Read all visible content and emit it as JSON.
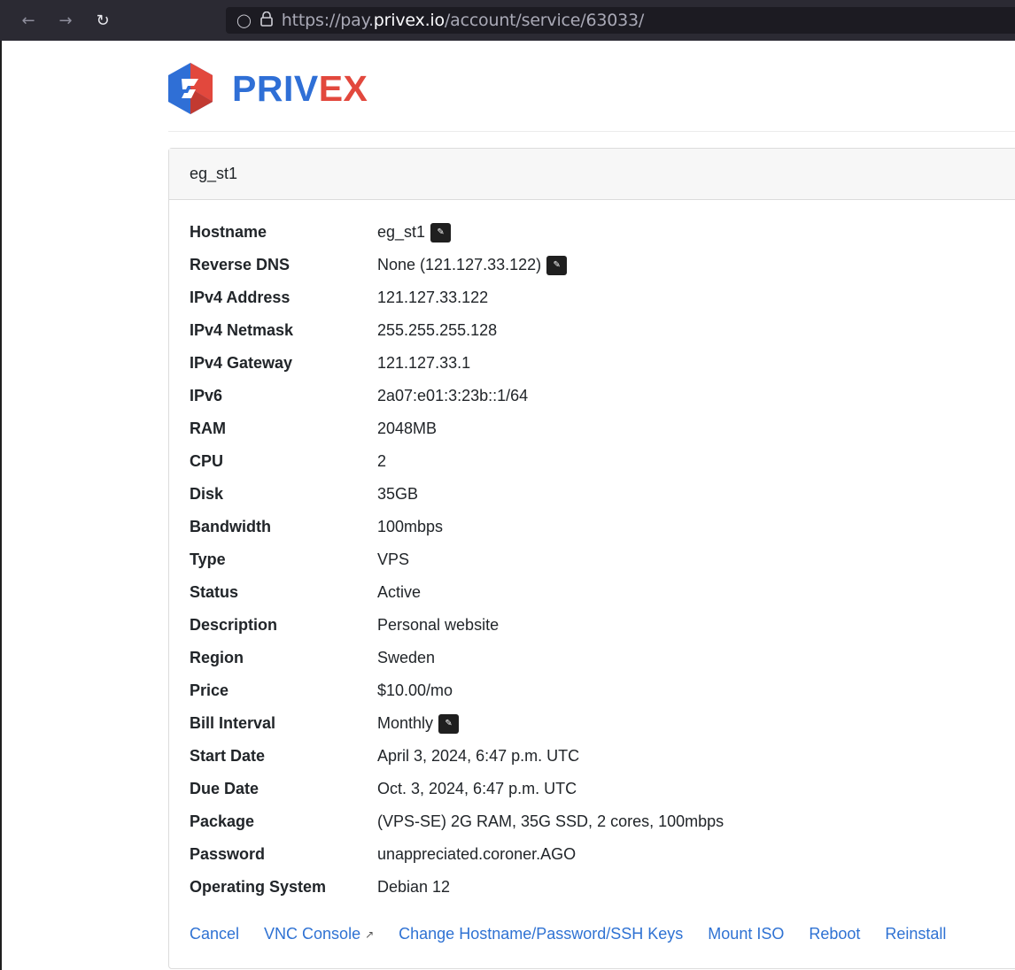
{
  "browser": {
    "url_prefix": "https://pay.",
    "url_domain": "privex.io",
    "url_path": "/account/service/63033/",
    "back_icon": "arrow-left-icon",
    "forward_icon": "arrow-right-icon",
    "reload_icon": "reload-icon"
  },
  "logo": {
    "part1": "PRIV",
    "part2": "EX",
    "colors": {
      "blue": "#2f6fd6",
      "red": "#e2483d"
    }
  },
  "card": {
    "title": "eg_st1",
    "rows": [
      {
        "label": "Hostname",
        "value": "eg_st1",
        "editable": true
      },
      {
        "label": "Reverse DNS",
        "value": "None (121.127.33.122)",
        "editable": true
      },
      {
        "label": "IPv4 Address",
        "value": "121.127.33.122"
      },
      {
        "label": "IPv4 Netmask",
        "value": "255.255.255.128"
      },
      {
        "label": "IPv4 Gateway",
        "value": "121.127.33.1"
      },
      {
        "label": "IPv6",
        "value": "2a07:e01:3:23b::1/64"
      },
      {
        "label": "RAM",
        "value": "2048MB"
      },
      {
        "label": "CPU",
        "value": "2"
      },
      {
        "label": "Disk",
        "value": "35GB"
      },
      {
        "label": "Bandwidth",
        "value": "100mbps"
      },
      {
        "label": "Type",
        "value": "VPS"
      },
      {
        "label": "Status",
        "value": "Active"
      },
      {
        "label": "Description",
        "value": "Personal website"
      },
      {
        "label": "Region",
        "value": "Sweden"
      },
      {
        "label": "Price",
        "value": "$10.00/mo"
      },
      {
        "label": "Bill Interval",
        "value": "Monthly",
        "editable": true
      },
      {
        "label": "Start Date",
        "value": "April 3, 2024, 6:47 p.m. UTC"
      },
      {
        "label": "Due Date",
        "value": "Oct. 3, 2024, 6:47 p.m. UTC"
      },
      {
        "label": "Package",
        "value": "(VPS-SE) 2G RAM, 35G SSD, 2 cores, 100mbps"
      },
      {
        "label": "Password",
        "value": "unappreciated.coroner.AGO"
      },
      {
        "label": "Operating System",
        "value": "Debian 12"
      }
    ],
    "actions": {
      "cancel": "Cancel",
      "vnc_console": "VNC Console",
      "change_hostname": "Change Hostname/Password/SSH Keys",
      "mount_iso": "Mount ISO",
      "reboot": "Reboot",
      "reinstall": "Reinstall"
    },
    "link_color": "#2f72d3"
  }
}
